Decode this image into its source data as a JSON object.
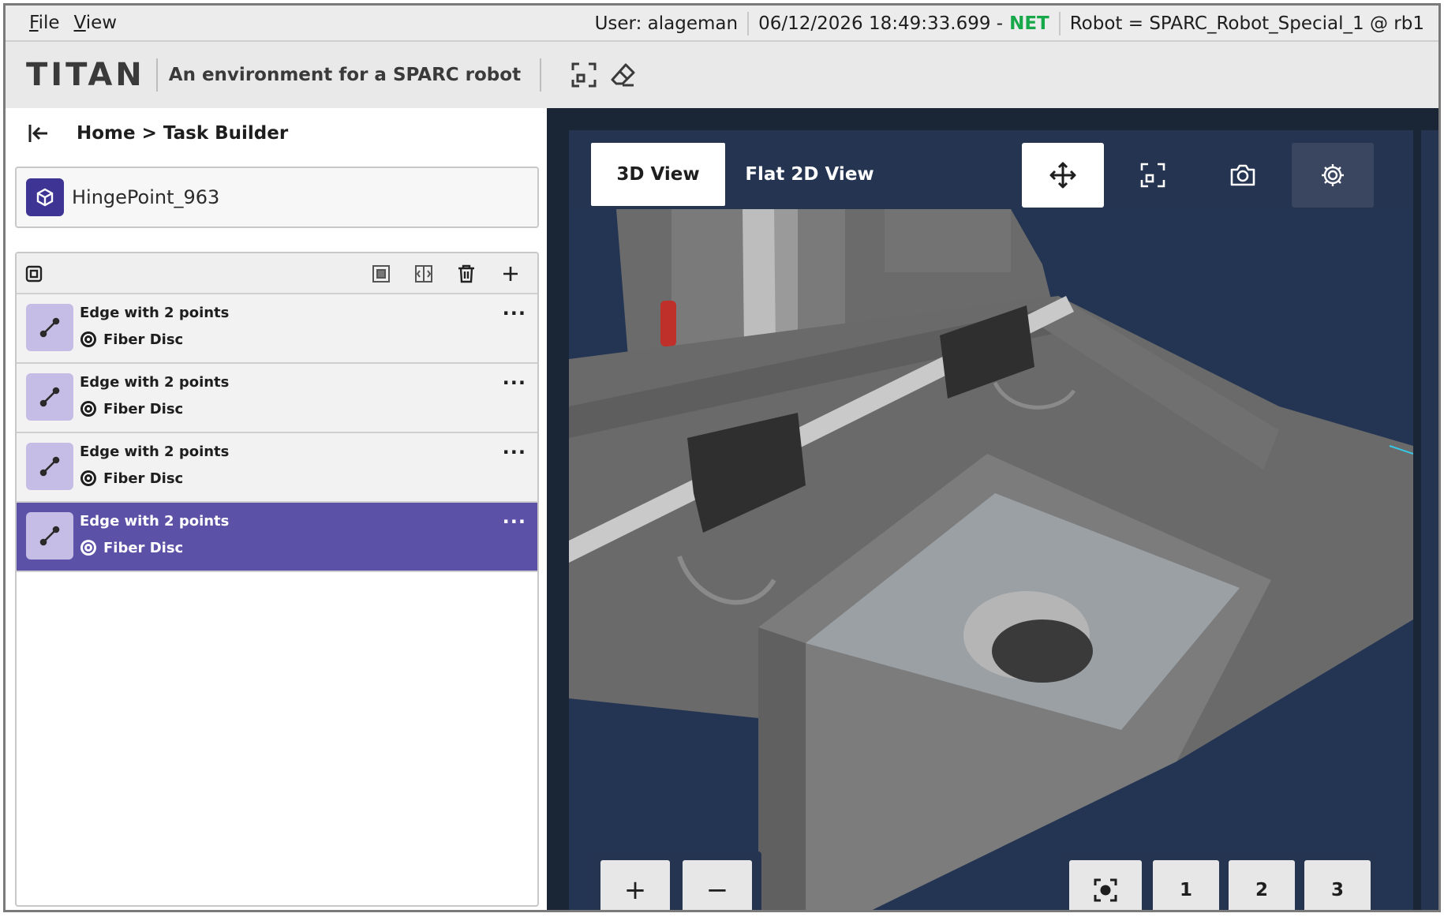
{
  "menubar": {
    "menus": [
      {
        "label": "File",
        "accel": "F",
        "rest": "ile"
      },
      {
        "label": "View",
        "accel": "V",
        "rest": "iew"
      }
    ],
    "user": "User: alageman",
    "timestamp": "06/12/2026 18:49:33.699 -",
    "network": "NET",
    "robot": "Robot = SPARC_Robot_Special_1 @ rb1"
  },
  "appbar": {
    "logo": "TITAN",
    "tagline": "An environment for a SPARC robot",
    "icons": [
      "frame-select-icon",
      "eraser-icon"
    ]
  },
  "leftpanel": {
    "breadcrumb": "Home > Task Builder",
    "point": {
      "name": "HingePoint_963",
      "icon": "hinge-point-icon"
    },
    "toolbar_icons": [
      "select-all-icon",
      "group-icon",
      "split-icon",
      "trash-icon",
      "plus-icon"
    ],
    "items": [
      {
        "title": "Edge with 2 points",
        "tool": "Fiber Disc",
        "selected": false
      },
      {
        "title": "Edge with 2 points",
        "tool": "Fiber Disc",
        "selected": false
      },
      {
        "title": "Edge with 2 points",
        "tool": "Fiber Disc",
        "selected": false
      },
      {
        "title": "Edge with 2 points",
        "tool": "Fiber Disc",
        "selected": true
      }
    ]
  },
  "viewer": {
    "tabs": [
      {
        "label": "3D View",
        "active": true
      },
      {
        "label": "Flat 2D View",
        "active": false
      }
    ],
    "tools": [
      "move-icon",
      "frame-select-icon",
      "camera-icon",
      "settings-gear-icon"
    ],
    "zoom": {
      "in": "+",
      "out": "−"
    },
    "camera": {
      "focus_icon": "focus-target-icon",
      "presets": [
        "1",
        "2",
        "3"
      ]
    }
  },
  "colors": {
    "accent": "#5b52a8",
    "point_icon_bg": "#3d3494",
    "item_icon_bg": "#c5bde6",
    "viewer_bg": "#253450",
    "net_status": "#17a84a"
  }
}
